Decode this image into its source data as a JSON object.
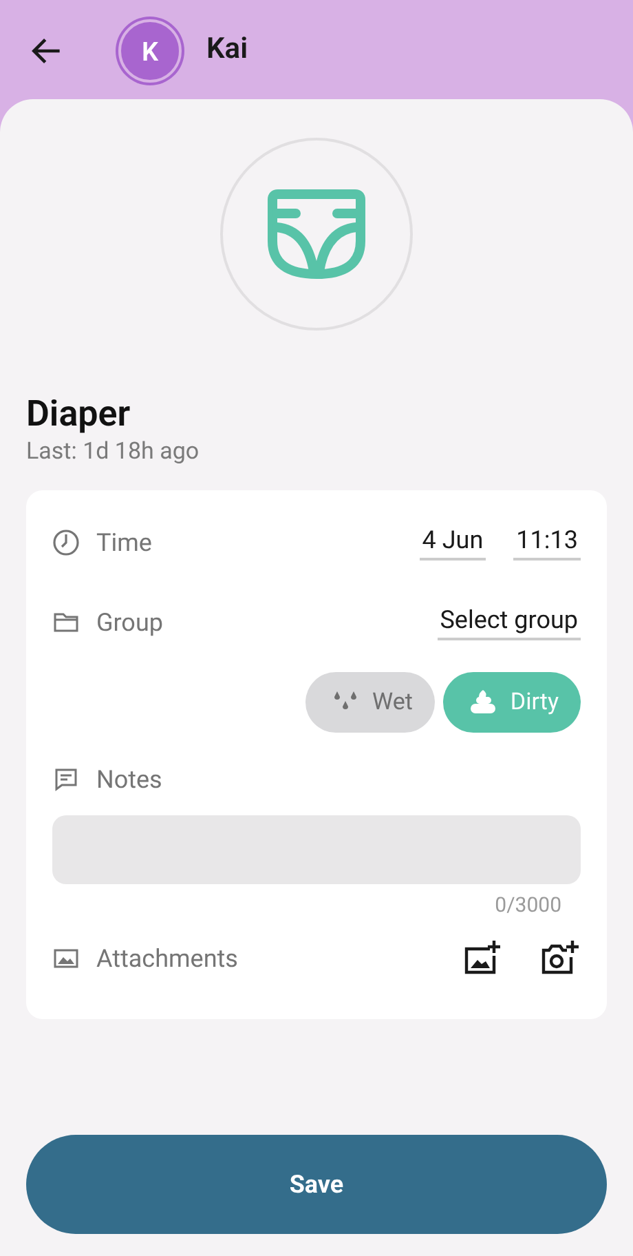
{
  "header": {
    "avatar_letter": "K",
    "name": "Kai"
  },
  "event": {
    "title": "Diaper",
    "subtitle": "Last: 1d 18h ago"
  },
  "form": {
    "time": {
      "label": "Time",
      "date": "4 Jun",
      "clock": "11:13"
    },
    "group": {
      "label": "Group",
      "value": "Select group"
    },
    "chips": [
      {
        "kind": "wet",
        "label": "Wet",
        "selected": false
      },
      {
        "kind": "dirty",
        "label": "Dirty",
        "selected": true
      }
    ],
    "notes": {
      "label": "Notes",
      "counter": "0/3000"
    },
    "attachments": {
      "label": "Attachments"
    }
  },
  "save_button": "Save"
}
